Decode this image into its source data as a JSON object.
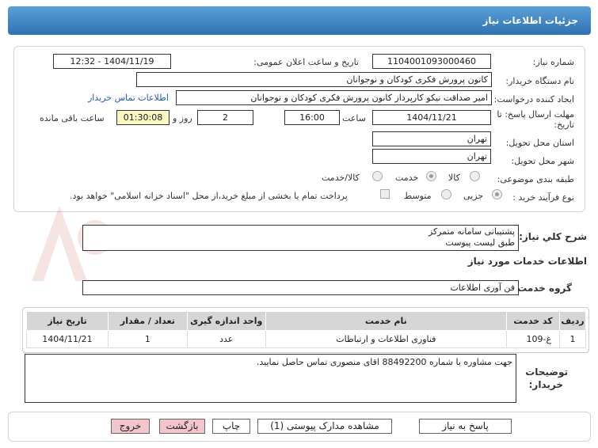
{
  "header": {
    "title": "جزئیات اطلاعات نیاز"
  },
  "form": {
    "need_number_label": "شماره نیاز:",
    "need_number": "1104001093000460",
    "announce_label": "تاریخ و ساعت اعلان عمومی:",
    "announce_value": "1404/11/19 - 12:32",
    "buyer_org_label": "نام دستگاه خریدار:",
    "buyer_org": "کانون پرورش فکری کودکان و نوجوانان",
    "creator_label": "ایجاد کننده درخواست:",
    "creator": "امیر صداقت نیکو کارپرداز کانون پرورش فکری کودکان و نوجوانان",
    "contact_link": "اطلاعات تماس خریدار",
    "deadline_label_1": "مهلت ارسال پاسخ: تا",
    "deadline_label_2": "تاریخ:",
    "deadline_date": "1404/11/21",
    "time_label": "ساعت",
    "deadline_time": "16:00",
    "days_value": "2",
    "days_label": "روز و",
    "remaining_time": "01:30:08",
    "remaining_label": "ساعت باقی مانده",
    "province_label": "استان محل تحویل:",
    "province": "تهران",
    "city_label": "شهر محل تحویل:",
    "city": "تهران",
    "category_label": "طبقه بندی موضوعی:",
    "category_options": [
      "کالا",
      "خدمت",
      "کالا/خدمت"
    ],
    "process_label": "نوع فرآیند خرید :",
    "process_options": [
      "جزیی",
      "متوسط"
    ],
    "payment_note": "پرداخت تمام یا بخشی از مبلغ خرید،از محل \"اسناد خزانه اسلامی\" خواهد بود."
  },
  "description": {
    "label": "شرح کلي نياز:",
    "line1": "پشتیبانی سامانه متمرکز",
    "line2": "طبق لیست پیوست"
  },
  "services": {
    "section_title": "اطلاعات خدمات مورد نیاز",
    "group_label": "گروه خدمت:",
    "group_value": "فن آوری اطلاعات",
    "columns": [
      "ردیف",
      "کد خدمت",
      "نام خدمت",
      "واحد اندازه گیری",
      "تعداد / مقدار",
      "تاریخ نیاز"
    ],
    "rows": [
      [
        "1",
        "غ-109",
        "فناوری اطلاعات و ارتباطات",
        "عدد",
        "1",
        "1404/11/21"
      ]
    ]
  },
  "buyer_notes": {
    "label_1": "توضیحات",
    "label_2": "خریدار:",
    "text": "جهت مشاوره با شماره 88492200 اقای منصوری تماس حاصل نمایید."
  },
  "buttons": {
    "reply": "پاسخ به نیاز",
    "attachments": "مشاهده مدارک پیوستی (1)",
    "print": "چاپ",
    "back": "بازگشت",
    "exit": "خروج"
  },
  "colors": {
    "header_blue": "#2f72b4",
    "remaining_bg": "#fbf7c0",
    "button_pink": "#f4c6cc",
    "link": "#1e5fc8"
  }
}
